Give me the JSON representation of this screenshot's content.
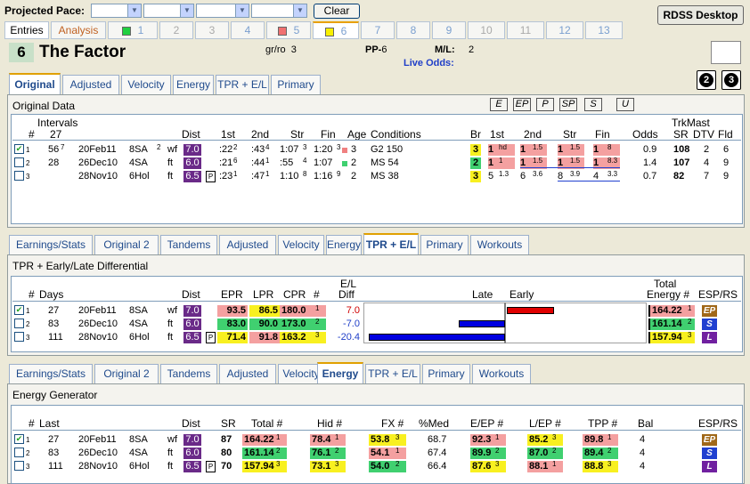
{
  "toolbar": {
    "label": "Projected Pace:",
    "clear": "Clear",
    "rdss": "RDSS Desktop"
  },
  "race_tabs": [
    {
      "label": "Entries"
    },
    {
      "label": "Analysis"
    },
    {
      "label": "1"
    },
    {
      "label": "2"
    },
    {
      "label": "3"
    },
    {
      "label": "4"
    },
    {
      "label": "5"
    },
    {
      "label": "6"
    },
    {
      "label": "7"
    },
    {
      "label": "8"
    },
    {
      "label": "9"
    },
    {
      "label": "10"
    },
    {
      "label": "11"
    },
    {
      "label": "12"
    },
    {
      "label": "13"
    }
  ],
  "horse": {
    "number": "6",
    "name": "The Factor",
    "grro_label": "gr/ro",
    "grro": "3",
    "pp_label": "PP-",
    "pp": "6",
    "ml_label": "M/L:",
    "ml": "2",
    "live_odds": "Live Odds:"
  },
  "circles": [
    "2",
    "3"
  ],
  "tabs_a": [
    "Original",
    "Adjusted",
    "Velocity",
    "Energy",
    "TPR + E/L",
    "Primary"
  ],
  "tabs_b": [
    "Earnings/Stats",
    "Original 2",
    "Tandems",
    "Adjusted",
    "Velocity",
    "Energy",
    "TPR + E/L",
    "Primary",
    "Workouts"
  ],
  "tabs_c": [
    "Earnings/Stats",
    "Original 2",
    "Tandems",
    "Adjusted",
    "Velocity",
    "Energy",
    "TPR + E/L",
    "Primary",
    "Workouts"
  ],
  "original": {
    "title": "Original Data",
    "buttons": [
      "E",
      "EP",
      "P",
      "SP",
      "S",
      "U"
    ],
    "headers": {
      "num": "#",
      "intervals": "Intervals",
      "intervals_val": "27",
      "dist": "Dist",
      "first": "1st",
      "second": "2nd",
      "str": "Str",
      "fin": "Fin",
      "age": "Age",
      "cond": "Conditions",
      "br": "Br",
      "c1": "1st",
      "c2": "2nd",
      "cstr": "Str",
      "cfin": "Fin",
      "odds": "Odds",
      "trkmast": "TrkMast",
      "sr": "SR",
      "dtv": "DTV",
      "fld": "Fld"
    },
    "rows": [
      {
        "n": "1",
        "int": "56",
        "int_s": "7",
        "date": "20Feb11",
        "trk": "8SA",
        "sup": "2",
        "surf": "wf",
        "dist": "7.0",
        "f1": ":22",
        "f1s": "2",
        "f2": ":43",
        "f2s": "4",
        "str": "1:07",
        "strs": "3",
        "fin": "1:20",
        "fins": "3",
        "age": "3",
        "cond": "G2 150",
        "br": "3",
        "p1": "1",
        "p1s": "hd",
        "p2": "1",
        "p2s": "1.5",
        "ps": "1",
        "pss": "1.5",
        "pf": "1",
        "pfs": "8",
        "odds": "0.9",
        "sr": "108",
        "dtv": "2",
        "fld": "6"
      },
      {
        "n": "2",
        "int": "28",
        "int_s": "",
        "date": "26Dec10",
        "trk": "4SA",
        "sup": "",
        "surf": "ft",
        "dist": "6.0",
        "f1": ":21",
        "f1s": "6",
        "f2": ":44",
        "f2s": "1",
        "str": ":55",
        "strs": "4",
        "fin": "1:07",
        "fins": "",
        "age": "2",
        "cond": "MS 54",
        "br": "2",
        "p1": "1",
        "p1s": "1",
        "p2": "1",
        "p2s": "1.5",
        "ps": "1",
        "pss": "1.5",
        "pf": "1",
        "pfs": "8.3",
        "odds": "1.4",
        "sr": "107",
        "dtv": "4",
        "fld": "9"
      },
      {
        "n": "3",
        "int": "",
        "int_s": "",
        "date": "28Nov10",
        "trk": "6Hol",
        "sup": "",
        "surf": "ft",
        "dist": "6.5",
        "f1": ":23",
        "f1s": "1",
        "f2": ":47",
        "f2s": "1",
        "str": "1:10",
        "strs": "8",
        "fin": "1:16",
        "fins": "9",
        "age": "2",
        "cond": "MS 38",
        "br": "3",
        "p1": "5",
        "p1s": "1.3",
        "p2": "6",
        "p2s": "3.6",
        "ps": "8",
        "pss": "3.9",
        "pf": "4",
        "pfs": "3.3",
        "odds": "0.7",
        "sr": "82",
        "dtv": "7",
        "fld": "9"
      }
    ]
  },
  "tpr": {
    "title": "TPR + Early/Late Differential",
    "headers": {
      "num": "#",
      "days": "Days",
      "dist": "Dist",
      "epr": "EPR",
      "lpr": "LPR",
      "cpr": "CPR",
      "hash": "#",
      "el1": "E/L",
      "el2": "Diff",
      "late": "Late",
      "early": "Early",
      "total1": "Total",
      "total2": "Energy #",
      "esp": "ESP/RS"
    },
    "rows": [
      {
        "n": "1",
        "days": "27",
        "date": "20Feb11",
        "trk": "8SA",
        "surf": "wf",
        "dist": "7.0",
        "epr": "93.5",
        "lpr": "86.5",
        "cpr": "180.0",
        "cprr": "1",
        "diff": "7.0",
        "energy": "164.22",
        "er": "1",
        "esp": "EP"
      },
      {
        "n": "2",
        "days": "83",
        "date": "26Dec10",
        "trk": "4SA",
        "surf": "ft",
        "dist": "6.0",
        "epr": "83.0",
        "lpr": "90.0",
        "cpr": "173.0",
        "cprr": "2",
        "diff": "-7.0",
        "energy": "161.14",
        "er": "2",
        "esp": "S"
      },
      {
        "n": "3",
        "days": "111",
        "date": "28Nov10",
        "trk": "6Hol",
        "surf": "ft",
        "dist": "6.5",
        "epr": "71.4",
        "lpr": "91.8",
        "cpr": "163.2",
        "cprr": "3",
        "diff": "-20.4",
        "energy": "157.94",
        "er": "3",
        "esp": "L"
      }
    ],
    "el_values": [
      7.0,
      -7.0,
      -20.4
    ]
  },
  "energy": {
    "title": "Energy Generator",
    "headers": {
      "num": "#",
      "last": "Last",
      "dist": "Dist",
      "sr": "SR",
      "total": "Total #",
      "hid": "Hid #",
      "fx": "FX #",
      "med": "%Med",
      "eep": "E/EP #",
      "lep": "L/EP #",
      "tpp": "TPP #",
      "bal": "Bal",
      "esp": "ESP/RS"
    },
    "rows": [
      {
        "n": "1",
        "last": "27",
        "date": "20Feb11",
        "trk": "8SA",
        "surf": "wf",
        "dist": "7.0",
        "sr": "87",
        "total": "164.22",
        "tr": "1",
        "hid": "78.4",
        "hr": "1",
        "fx": "53.8",
        "fr": "3",
        "med": "68.7",
        "eep": "92.3",
        "er": "1",
        "lep": "85.2",
        "lr": "3",
        "tpp": "89.8",
        "pr": "1",
        "bal": "4",
        "esp": "EP"
      },
      {
        "n": "2",
        "last": "83",
        "date": "26Dec10",
        "trk": "4SA",
        "surf": "ft",
        "dist": "6.0",
        "sr": "80",
        "total": "161.14",
        "tr": "2",
        "hid": "76.1",
        "hr": "2",
        "fx": "54.1",
        "fr": "1",
        "med": "67.4",
        "eep": "89.9",
        "er": "2",
        "lep": "87.0",
        "lr": "2",
        "tpp": "89.4",
        "pr": "2",
        "bal": "4",
        "esp": "S"
      },
      {
        "n": "3",
        "last": "111",
        "date": "28Nov10",
        "trk": "6Hol",
        "surf": "ft",
        "dist": "6.5",
        "sr": "70",
        "total": "157.94",
        "tr": "3",
        "hid": "73.1",
        "hr": "3",
        "fx": "54.0",
        "fr": "2",
        "med": "66.4",
        "eep": "87.6",
        "er": "3",
        "lep": "88.1",
        "lr": "1",
        "tpp": "88.8",
        "pr": "3",
        "bal": "4",
        "esp": "L"
      }
    ]
  },
  "colors": {
    "purple": "#6a2a88",
    "pink": "#f4a0a0",
    "green": "#40d070",
    "yellow": "#f8f020",
    "blue": "#0000e0",
    "red": "#e00000"
  }
}
